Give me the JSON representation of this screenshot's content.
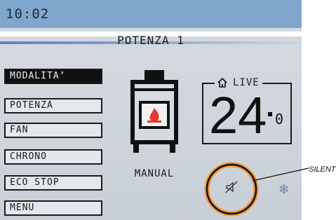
{
  "header": {
    "time": "10:02"
  },
  "screen": {
    "title": "POTENZA 1"
  },
  "menu": {
    "items": [
      {
        "label": "MODALITA’",
        "active": true
      },
      {
        "label": "POTENZA",
        "active": false
      },
      {
        "label": "FAN",
        "active": false
      },
      {
        "label": "CHRONO",
        "active": false
      },
      {
        "label": "ECO STOP",
        "active": false
      },
      {
        "label": "MENU",
        "active": false
      }
    ]
  },
  "stove": {
    "mode_label": "MANUAL",
    "icon": "stove-icon"
  },
  "live": {
    "label": "LIVE",
    "icon": "home-icon",
    "temperature_integer": "24",
    "temperature_decimal": "0"
  },
  "status": {
    "silent_label": "SILENT",
    "silent_icon": "speaker-muted-icon",
    "cool_icon": "snowflake-icon"
  },
  "colors": {
    "header_blue": "#7fa6cd",
    "annotation_orange": "#f0922e"
  }
}
